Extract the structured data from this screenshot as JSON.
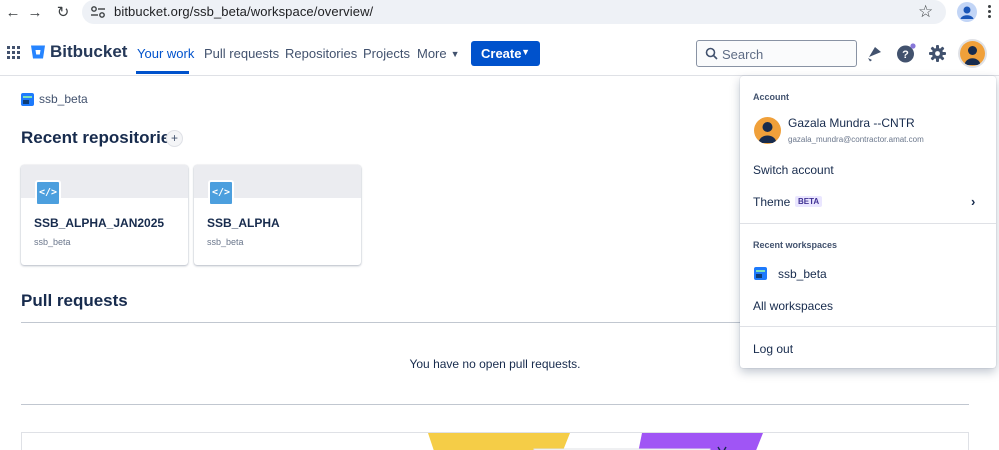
{
  "browser": {
    "url": "bitbucket.org/ssb_beta/workspace/overview/"
  },
  "header": {
    "brand": "Bitbucket",
    "nav": [
      "Your work",
      "Pull requests",
      "Repositories",
      "Projects",
      "More"
    ],
    "active_nav": "Your work",
    "create_label": "Create",
    "search_placeholder": "Search"
  },
  "workspace": {
    "name": "ssb_beta"
  },
  "recent_repositories": {
    "title": "Recent repositories",
    "repos": [
      {
        "name": "SSB_ALPHA_JAN2025",
        "workspace": "ssb_beta"
      },
      {
        "name": "SSB_ALPHA",
        "workspace": "ssb_beta"
      }
    ]
  },
  "pull_requests": {
    "title": "Pull requests",
    "empty_message": "You have no open pull requests."
  },
  "account_menu": {
    "account_heading": "Account",
    "user_name": "Gazala Mundra --CNTR",
    "user_email": "gazala_mundra@contractor.amat.com",
    "switch_account": "Switch account",
    "theme_label": "Theme",
    "theme_badge": "BETA",
    "recent_workspaces_heading": "Recent workspaces",
    "recent_workspace": "ssb_beta",
    "all_workspaces": "All workspaces",
    "log_out": "Log out"
  },
  "colors": {
    "accent": "#0052cc",
    "repo_icon": "#4c9fde",
    "avatar": "#f0a03a",
    "promo_yellow": "#f5cd47",
    "promo_purple": "#a055f5"
  }
}
